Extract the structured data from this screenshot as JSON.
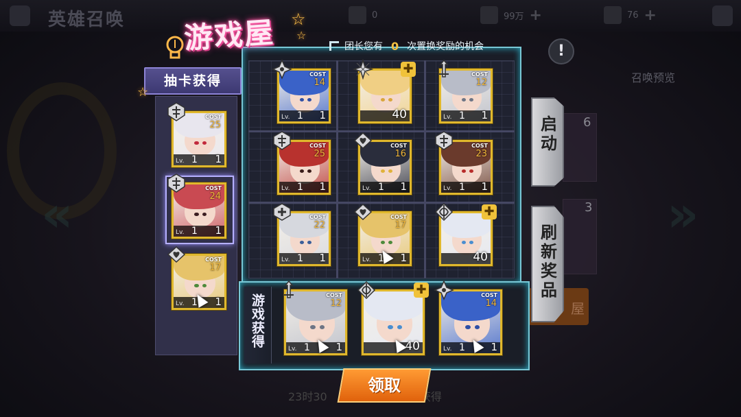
{
  "background": {
    "title": "英雄召唤",
    "resources": [
      {
        "value": "0"
      },
      {
        "value": "99万"
      },
      {
        "value": "76"
      }
    ],
    "preview_label": "召唤预览",
    "side_count_top": "6",
    "side_count_bottom": "3",
    "orange_button_text": "屋",
    "bottom_hint_left": "23时30",
    "bottom_hint_right": "获得"
  },
  "modal": {
    "title": "游戏屋",
    "notice_prefix": "团长您有",
    "notice_count": "0",
    "notice_suffix": "次置换奖励的机会",
    "draw_tab_label": "抽卡获得",
    "game_earned_label": "游戏获得",
    "start_button": "启动",
    "refresh_button": "刷新奖品",
    "claim_button": "领取",
    "cost_label": "COST",
    "level_label": "Lv."
  },
  "draw_cards": [
    {
      "cost": "25",
      "level": "1",
      "count": "1",
      "class": "tank",
      "hair": "#e8e6ee",
      "eye": "#c22a3c",
      "selected": false
    },
    {
      "cost": "24",
      "level": "1",
      "count": "1",
      "class": "tank",
      "hair": "#c94a52",
      "eye": "#3c1e22",
      "selected": true
    },
    {
      "cost": "17",
      "level": "1",
      "count": "1",
      "class": "support",
      "hair": "#e6c36a",
      "eye": "#4d8a3a",
      "selected": false
    }
  ],
  "grid_cards": [
    {
      "cost": "14",
      "level": "1",
      "count": "1",
      "class": "assassin",
      "hair": "#3a62c8",
      "eye": "#2e4fa6",
      "puzzle": false
    },
    {
      "cost": "",
      "level": "",
      "count": "40",
      "class": "mage",
      "hair": "#f0cf84",
      "eye": "#d9a53c",
      "puzzle": true
    },
    {
      "cost": "12",
      "level": "1",
      "count": "1",
      "class": "warrior",
      "hair": "#b8bcc8",
      "eye": "#6d7585",
      "puzzle": false
    },
    {
      "cost": "25",
      "level": "1",
      "count": "1",
      "class": "tank",
      "hair": "#b8322e",
      "eye": "#3a1d1a",
      "puzzle": false
    },
    {
      "cost": "16",
      "level": "1",
      "count": "1",
      "class": "support",
      "hair": "#2a2d3c",
      "eye": "#e0b23a",
      "puzzle": false
    },
    {
      "cost": "23",
      "level": "1",
      "count": "1",
      "class": "tank",
      "hair": "#6a3a2c",
      "eye": "#b82c2a",
      "puzzle": false
    },
    {
      "cost": "22",
      "level": "1",
      "count": "1",
      "class": "guardian",
      "hair": "#d6d8de",
      "eye": "#3a5f9a",
      "puzzle": false
    },
    {
      "cost": "17",
      "level": "1",
      "count": "1",
      "class": "support",
      "hair": "#e6c36a",
      "eye": "#4d8a3a",
      "puzzle": false
    },
    {
      "cost": "",
      "level": "",
      "count": "40",
      "class": "archer",
      "hair": "#e4e8f2",
      "eye": "#4a8ed0",
      "puzzle": true
    }
  ],
  "earned_cards": [
    {
      "cost": "12",
      "level": "1",
      "count": "1",
      "class": "warrior",
      "hair": "#b8bcc8",
      "eye": "#6d7585",
      "puzzle": false
    },
    {
      "cost": "",
      "level": "",
      "count": "40",
      "class": "archer",
      "hair": "#e4e8f2",
      "eye": "#4a8ed0",
      "puzzle": true
    },
    {
      "cost": "14",
      "level": "1",
      "count": "1",
      "class": "assassin",
      "hair": "#3a62c8",
      "eye": "#2e4fa6",
      "puzzle": false
    }
  ],
  "colors": {
    "accent_cyan": "#79c8d6",
    "card_border_gold": "#e0b82d",
    "claim_orange": "#ff8a1f",
    "title_pink": "#ff3d96"
  }
}
